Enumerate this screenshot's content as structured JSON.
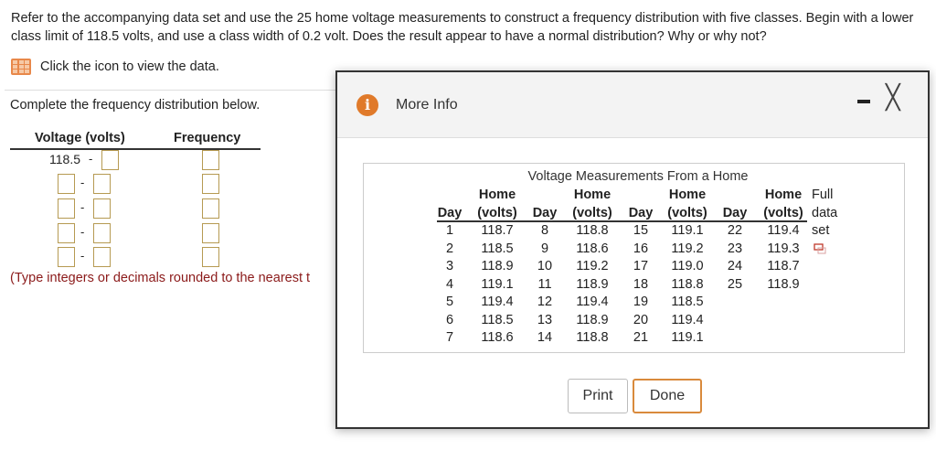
{
  "question": "Refer to the accompanying data set and use the 25 home voltage measurements to construct a frequency distribution with five classes. Begin with a lower class limit of 118.5 volts, and use a class width of 0.2 volt. Does the result appear to have a normal distribution? Why or why not?",
  "data_link": "Click the icon to view the data.",
  "instruction": "Complete the frequency distribution below.",
  "freq_table": {
    "headers": [
      "Voltage (volts)",
      "Frequency"
    ],
    "first_lower": "118.5",
    "dash": "-"
  },
  "hint": "(Type integers or decimals rounded to the nearest t",
  "dialog": {
    "title": "More Info",
    "info_glyph": "i",
    "close_glyph": "╳",
    "table_title": "Voltage Measurements From a Home",
    "col_top": "Home",
    "col_day": "Day",
    "col_volts": "(volts)",
    "full_data": [
      "Full",
      "data",
      "set"
    ],
    "columns": [
      {
        "days": [
          "1",
          "2",
          "3",
          "4",
          "5",
          "6",
          "7"
        ],
        "volts": [
          "118.7",
          "118.5",
          "118.9",
          "119.1",
          "119.4",
          "118.5",
          "118.6"
        ]
      },
      {
        "days": [
          "8",
          "9",
          "10",
          "11",
          "12",
          "13",
          "14"
        ],
        "volts": [
          "118.8",
          "118.6",
          "119.2",
          "118.9",
          "119.4",
          "118.9",
          "118.8"
        ]
      },
      {
        "days": [
          "15",
          "16",
          "17",
          "18",
          "19",
          "20",
          "21"
        ],
        "volts": [
          "119.1",
          "119.2",
          "119.0",
          "118.8",
          "118.5",
          "119.4",
          "119.1"
        ]
      },
      {
        "days": [
          "22",
          "23",
          "24",
          "25"
        ],
        "volts": [
          "119.4",
          "119.3",
          "118.7",
          "118.9"
        ]
      }
    ],
    "print_label": "Print",
    "done_label": "Done"
  }
}
